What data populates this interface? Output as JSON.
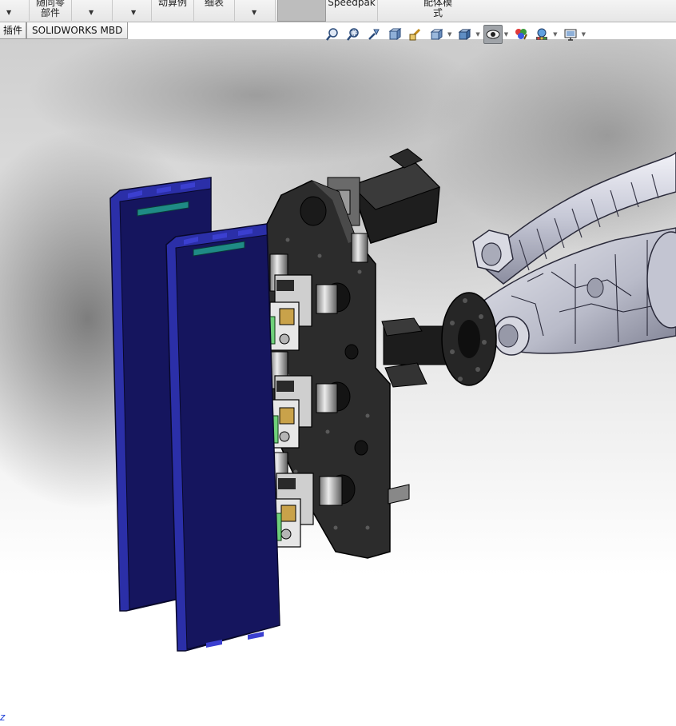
{
  "ribbon": {
    "items": [
      {
        "label": "",
        "has_arrow": true
      },
      {
        "label": "部件",
        "label_top": "随同零",
        "has_arrow": false
      },
      {
        "label": "",
        "has_arrow": true
      },
      {
        "label": "",
        "has_arrow": true
      },
      {
        "label": "动算例",
        "has_arrow": false
      },
      {
        "label": "细表",
        "has_arrow": false
      },
      {
        "label": "",
        "has_arrow": true
      },
      {
        "label": "Speedpak",
        "has_arrow": false
      },
      {
        "label": "式",
        "label_top": "配体模",
        "has_arrow": false
      }
    ]
  },
  "tabs": [
    {
      "label": "插件"
    },
    {
      "label": "SOLIDWORKS MBD"
    }
  ],
  "hud_toolbar": [
    {
      "name": "zoom-to-fit-icon"
    },
    {
      "name": "zoom-to-area-icon"
    },
    {
      "name": "previous-view-icon"
    },
    {
      "name": "section-view-icon"
    },
    {
      "name": "dynamic-annotation-icon"
    },
    {
      "name": "view-orientation-icon",
      "dropdown": true
    },
    {
      "name": "display-style-icon",
      "dropdown": true
    },
    {
      "name": "hide-show-items-icon",
      "dropdown": true,
      "active": true
    },
    {
      "name": "edit-appearance-icon"
    },
    {
      "name": "apply-scene-icon",
      "dropdown": true
    },
    {
      "name": "view-settings-icon",
      "dropdown": true
    }
  ],
  "viewport": {
    "triad_axis": "z"
  },
  "colors": {
    "panel_blue": "#2b2fa8",
    "panel_face": "#15155e",
    "plate_dark": "#2a2a2a",
    "connector_green": "#3fae4a",
    "robot_gray": "#c9cbd6"
  }
}
